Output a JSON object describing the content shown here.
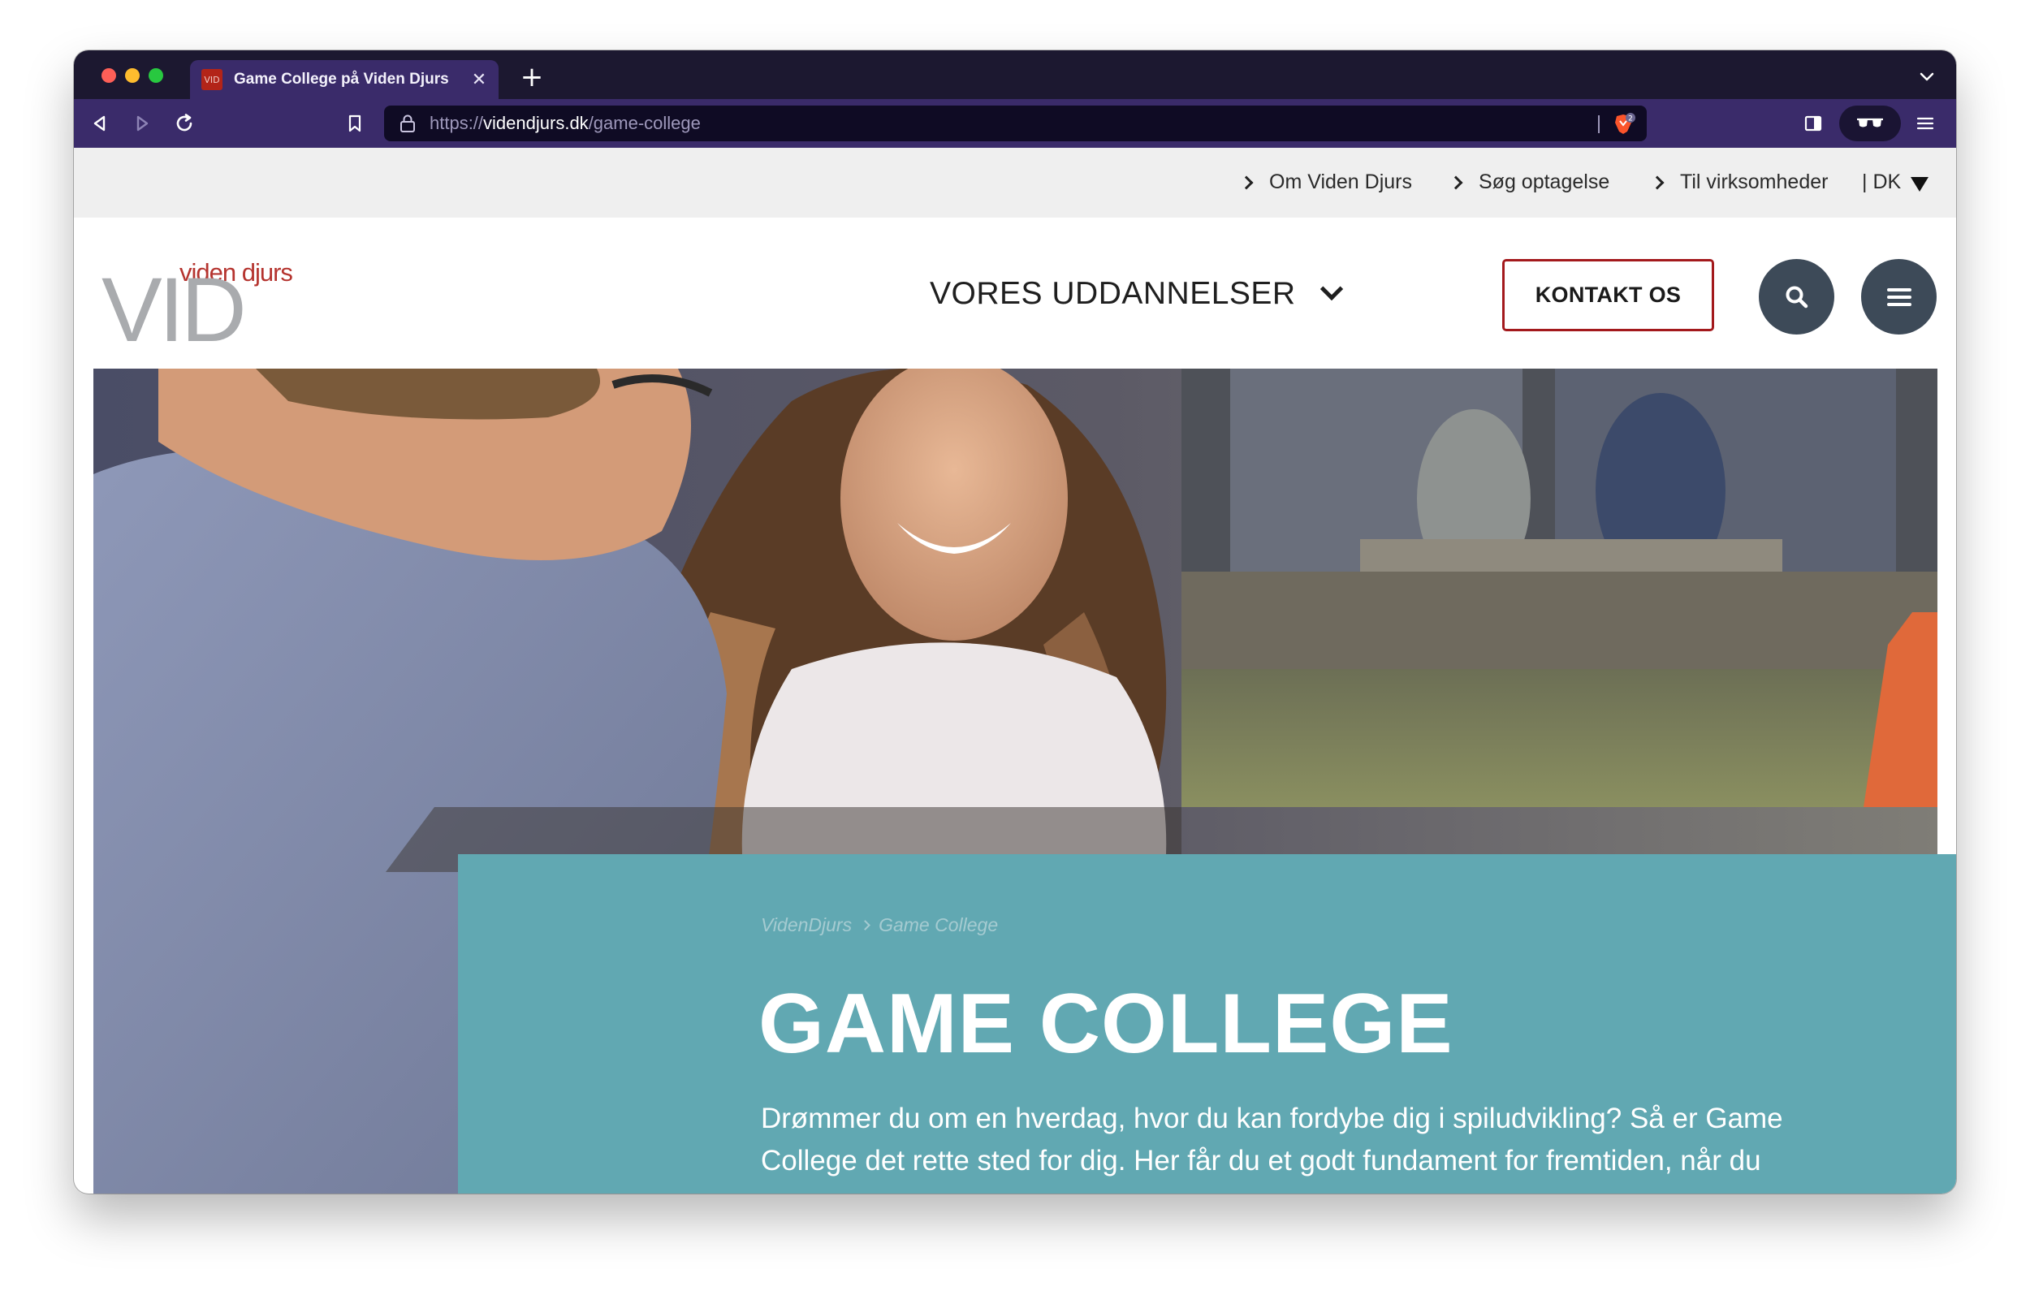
{
  "browser": {
    "tab_title": "Game College på Viden Djurs",
    "tab_favicon_text": "VID",
    "url_prefix": "https://",
    "url_host": "videndjurs.dk",
    "url_path": "/game-college",
    "shield_count": "2"
  },
  "topbar": {
    "links": [
      "Om Viden Djurs",
      "Søg optagelse",
      "Til virksomheder"
    ],
    "language": "|  DK"
  },
  "header": {
    "logo_tagline": "viden djurs",
    "logo_mark": "VID",
    "nav_label": "VORES UDDANNELSER",
    "contact_label": "KONTAKT OS"
  },
  "hero": {
    "breadcrumb": [
      "VidenDjurs",
      "Game College"
    ],
    "title": "GAME COLLEGE",
    "intro": "Drømmer du om en hverdag, hvor du kan fordybe dig i spiludvikling? Så er Game College det rette sted for dig. Her får du et godt fundament for fremtiden, når du"
  },
  "colors": {
    "browser_chrome": "#3a2b6a",
    "accent_red": "#a3191c",
    "hero_panel": "#61a8b2",
    "icon_button": "#3d4a58"
  },
  "icons": [
    "back-icon",
    "forward-icon",
    "reload-icon",
    "bookmark-icon",
    "lock-icon",
    "brave-shield-icon",
    "sidebar-icon",
    "reader-mode-icon",
    "menu-icon",
    "search-icon",
    "hamburger-icon",
    "chevron-down-icon"
  ]
}
